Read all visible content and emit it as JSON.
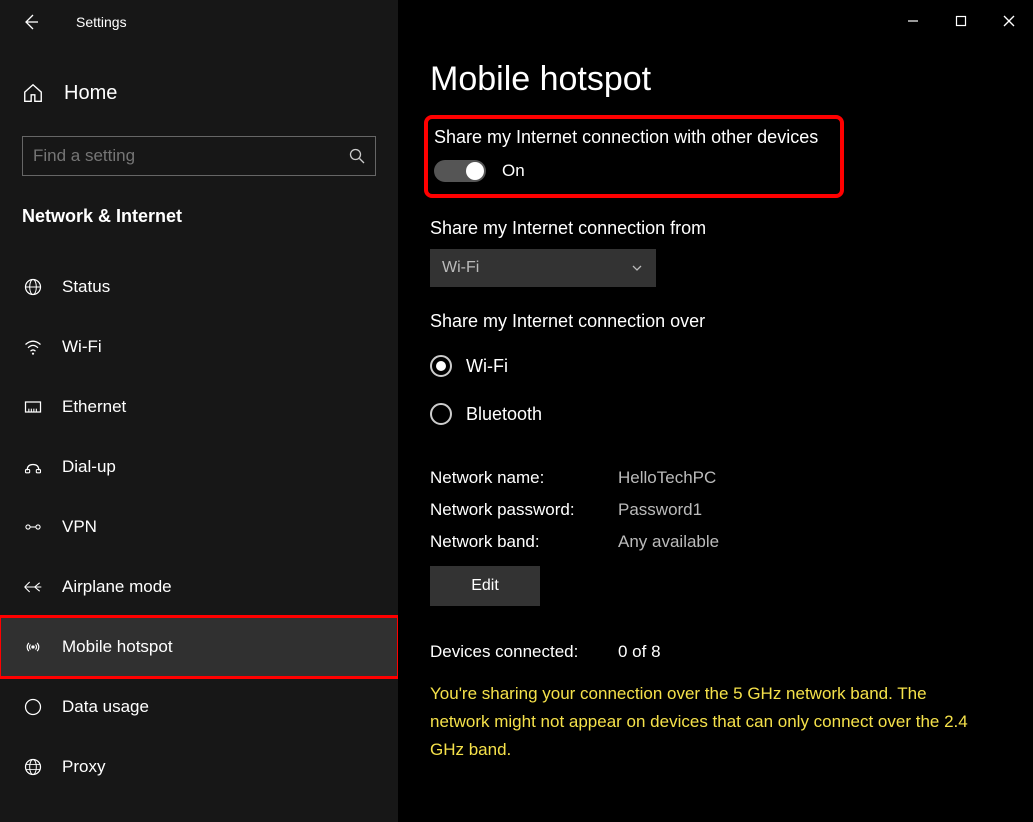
{
  "window": {
    "title": "Settings"
  },
  "sidebar": {
    "home": "Home",
    "search_placeholder": "Find a setting",
    "category": "Network & Internet",
    "items": [
      {
        "label": "Status"
      },
      {
        "label": "Wi-Fi"
      },
      {
        "label": "Ethernet"
      },
      {
        "label": "Dial-up"
      },
      {
        "label": "VPN"
      },
      {
        "label": "Airplane mode"
      },
      {
        "label": "Mobile hotspot"
      },
      {
        "label": "Data usage"
      },
      {
        "label": "Proxy"
      }
    ]
  },
  "main": {
    "title": "Mobile hotspot",
    "share_label": "Share my Internet connection with other devices",
    "toggle_state": "On",
    "share_from_label": "Share my Internet connection from",
    "share_from_value": "Wi-Fi",
    "share_over_label": "Share my Internet connection over",
    "radio_wifi": "Wi-Fi",
    "radio_bt": "Bluetooth",
    "net_name_key": "Network name:",
    "net_name_val": "HelloTechPC",
    "net_pwd_key": "Network password:",
    "net_pwd_val": "Password1",
    "net_band_key": "Network band:",
    "net_band_val": "Any available",
    "edit_label": "Edit",
    "devices_key": "Devices connected:",
    "devices_val": "0 of 8",
    "warning": "You're sharing your connection over the 5 GHz network band. The network might not appear on devices that can only connect over the 2.4 GHz band."
  }
}
